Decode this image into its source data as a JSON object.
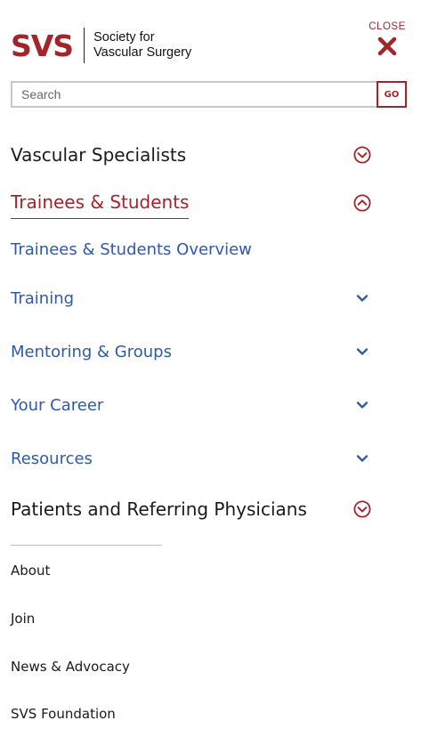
{
  "logo": {
    "abbr": "SVS",
    "name_line1": "Society for",
    "name_line2": "Vascular Surgery"
  },
  "close": {
    "label": "CLOSE"
  },
  "search": {
    "placeholder": "Search",
    "button_label": "GO"
  },
  "nav": {
    "items": [
      {
        "label": "Vascular Specialists",
        "expanded": false
      },
      {
        "label": "Trainees & Students",
        "expanded": true,
        "overview_label": "Trainees & Students Overview",
        "children": [
          {
            "label": "Training"
          },
          {
            "label": "Mentoring & Groups"
          },
          {
            "label": "Your Career"
          },
          {
            "label": "Resources"
          }
        ]
      },
      {
        "label": "Patients and Referring Physicians",
        "expanded": false
      }
    ]
  },
  "utility_links": [
    "About",
    "Join",
    "News & Advocacy",
    "SVS Foundation"
  ],
  "colors": {
    "brand": "#a3242b",
    "link": "#2f5aa8",
    "text": "#1a1a1a",
    "divider": "#bdbdbd"
  },
  "icons": {
    "close": "close-x-icon",
    "collapsed_toggle": "circle-chevron-down-icon",
    "expanded_toggle": "circle-chevron-up-icon",
    "child_toggle": "chevron-down-icon"
  }
}
